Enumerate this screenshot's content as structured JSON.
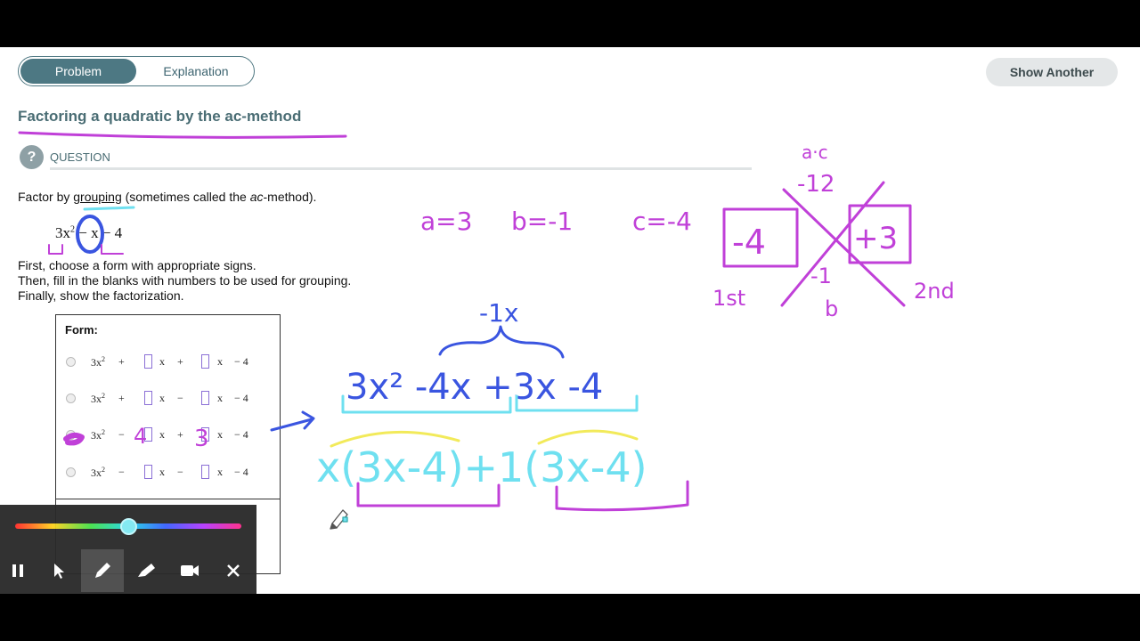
{
  "tabs": [
    {
      "label": "Problem",
      "active": true
    },
    {
      "label": "Explanation",
      "active": false
    }
  ],
  "show_another_label": "Show Another",
  "title": "Factoring a quadratic by the ac-method",
  "question_icon": "?",
  "question_label": "QUESTION",
  "instruction": {
    "pre": "Factor by ",
    "underlined": "grouping",
    "mid": " (sometimes called the ",
    "italic": "ac",
    "post": "-method)."
  },
  "expression": {
    "base": "3x",
    "exp": "2",
    "rest": " − x − 4"
  },
  "steps": [
    "First, choose a form with appropriate signs.",
    "Then, fill in the blanks with numbers to be used for grouping.",
    "Finally, show the factorization."
  ],
  "form": {
    "title": "Form:",
    "options": [
      {
        "lead": "3x",
        "exp": "2",
        "sign1": "+",
        "sign2": "+",
        "tail": "− 4",
        "selected": false
      },
      {
        "lead": "3x",
        "exp": "2",
        "sign1": "+",
        "sign2": "−",
        "tail": "− 4",
        "selected": false
      },
      {
        "lead": "3x",
        "exp": "2",
        "sign1": "−",
        "sign2": "+",
        "tail": "− 4",
        "selected": true
      },
      {
        "lead": "3x",
        "exp": "2",
        "sign1": "−",
        "sign2": "−",
        "tail": "− 4",
        "selected": false
      }
    ],
    "x_label": "x"
  },
  "toolbar": {
    "buttons": [
      "pause-icon",
      "pointer-icon",
      "pen-icon",
      "highlighter-icon",
      "camera-icon",
      "close-icon"
    ],
    "active": "pen-icon",
    "color_level": 0.5
  },
  "colors": {
    "accent": "#4d7883",
    "ink_purple": "#c040d8",
    "ink_blue": "#3a55e0",
    "ink_cyan": "#6fe0f0",
    "ink_yellow": "#f2ea5a"
  },
  "annotations": {
    "a": "a=3",
    "b": "b=-1",
    "c": "c=-4",
    "ac_top": "a·c",
    "ac_val": "-12",
    "box_left": "-4",
    "box_right": "+3",
    "cross_bottom_top": "-1",
    "cross_bottom": "b",
    "first": "1st",
    "second": "2nd",
    "brace_label": "-1x",
    "expanded": "3x² -4x +3x -4",
    "factored": "x(3x-4)+1(3x-4)",
    "fill1": "4",
    "fill2": "3"
  }
}
